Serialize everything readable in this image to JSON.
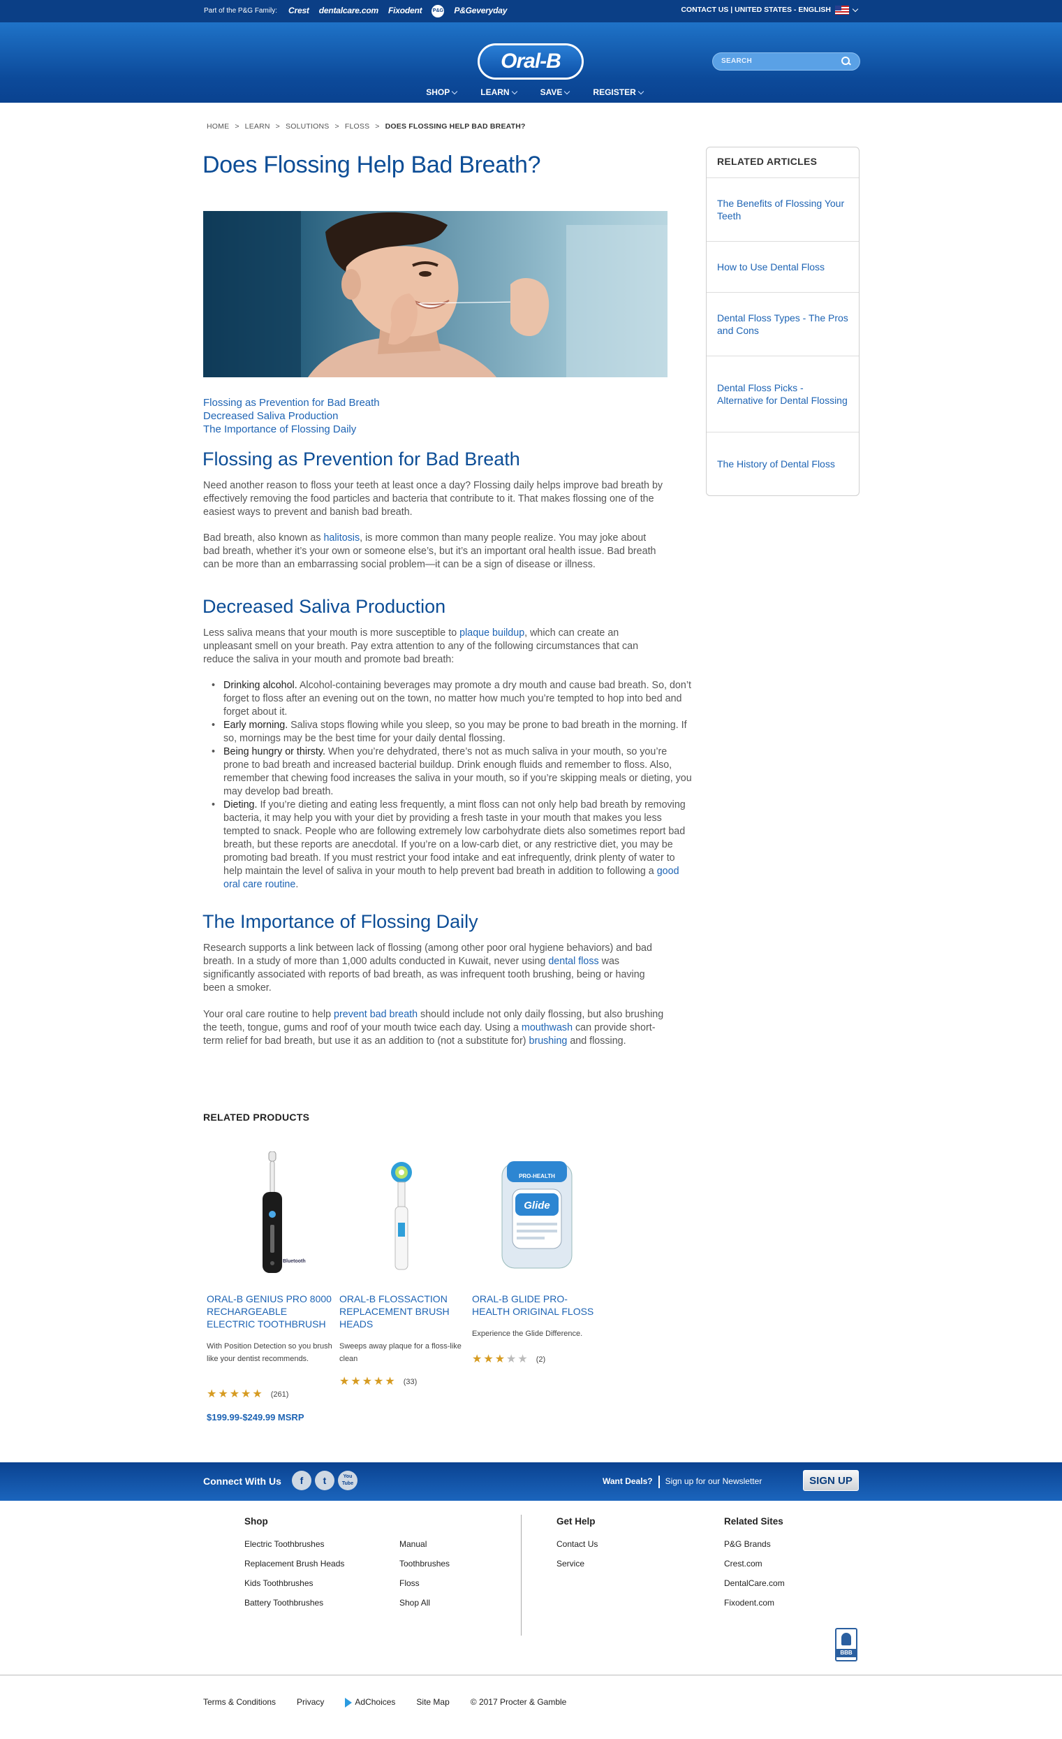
{
  "topbar": {
    "family_label": "Part of the P&G Family:",
    "brands": [
      "Crest",
      "dentalcare.com",
      "Fixodent",
      "P&G shop",
      "P&Geveryday"
    ],
    "right_text": "CONTACT US | UNITED STATES - ENGLISH"
  },
  "header": {
    "logo": "Oral-B",
    "search_placeholder": "SEARCH",
    "nav": [
      "SHOP",
      "LEARN",
      "SAVE",
      "REGISTER"
    ]
  },
  "breadcrumb": [
    "HOME",
    ">",
    "LEARN",
    ">",
    "SOLUTIONS",
    ">",
    "FLOSS",
    ">",
    "DOES FLOSSING HELP BAD BREATH?"
  ],
  "article": {
    "title": "Does Flossing Help Bad Breath?",
    "toc": [
      "Flossing as Prevention for Bad Breath",
      "Decreased Saliva Production",
      "The Importance of Flossing Daily"
    ],
    "h_prevention": "Flossing as Prevention for Bad Breath",
    "p1": "Need another reason to floss your teeth at least once a day? Flossing daily helps improve bad breath by effectively removing the food particles and bacteria that contribute to it. That makes flossing one of the easiest ways to prevent and banish bad breath.",
    "p2_a": "Bad breath, also known as ",
    "p2_link": "halitosis",
    "p2_b": ", is more common than many people realize. You may joke about bad breath, whether it’s your own or someone else’s, but it’s an important oral health issue. Bad breath can be more than an embarrassing social problem—it can be a sign of disease or illness.",
    "h_saliva": "Decreased Saliva Production",
    "p3_a": "Less saliva means that your mouth is more susceptible to ",
    "p3_link": "plaque buildup",
    "p3_b": ", which can create an unpleasant smell on your breath. Pay extra attention to any of the following circumstances that can reduce the saliva in your mouth and promote bad breath:",
    "bullets": [
      {
        "key": "Drinking alcohol.",
        "text": " Alcohol-containing beverages may promote a dry mouth and cause bad breath. So, don’t forget to floss after an evening out on the town, no matter how much you’re tempted to hop into bed and forget about it."
      },
      {
        "key": "Early morning.",
        "text": " Saliva stops flowing while you sleep, so you may be prone to bad breath in the morning. If so, mornings may be the best time for your daily dental flossing."
      },
      {
        "key": "Being hungry or thirsty.",
        "text": " When you’re dehydrated, there’s not as much saliva in your mouth, so you’re prone to bad breath and increased bacterial buildup. Drink enough fluids and remember to floss. Also, remember that chewing food increases the saliva in your mouth, so if you’re skipping meals or dieting, you may develop bad breath."
      },
      {
        "key": "Dieting.",
        "text": " If you’re dieting and eating less frequently, a mint floss can not only help bad breath by removing bacteria, it may help you with your diet by providing a fresh taste in your mouth that makes you less tempted to snack. People who are following extremely low carbohydrate diets also sometimes report bad breath, but these reports are anecdotal. If you’re on a low-carb diet, or any restrictive diet, you may be promoting bad breath. If you must restrict your food intake and eat infrequently, drink plenty of water to help maintain the level of saliva in your mouth to help prevent bad breath in addition to following a ",
        "link": "good oral care routine",
        "end": "."
      }
    ],
    "h_importance": "The Importance of Flossing Daily",
    "p4_a": "Research supports a link between lack of flossing (among other poor oral hygiene behaviors) and bad breath. In a study of more than 1,000 adults conducted in Kuwait, never using ",
    "p4_link": "dental floss",
    "p4_b": " was significantly associated with reports of bad breath, as was infrequent tooth brushing, being or having been a smoker.",
    "p5_a": "Your oral care routine to help ",
    "p5_link1": "prevent bad breath",
    "p5_b": " should include not only daily flossing, but also brushing the teeth, tongue, gums and roof of your mouth twice each day. Using a ",
    "p5_link2": "mouthwash",
    "p5_c": " can provide short-term relief for bad breath, but use it as an addition to (not a substitute for) ",
    "p5_link3": "brushing",
    "p5_d": " and flossing."
  },
  "sidebar": {
    "heading": "RELATED ARTICLES",
    "items": [
      "The Benefits of Flossing Your Teeth",
      "How to Use Dental Floss",
      "Dental Floss Types - The Pros and Cons",
      "Dental Floss Picks - Alternative for Dental Flossing",
      "The History of Dental Floss"
    ]
  },
  "related_products": {
    "heading": "RELATED PRODUCTS",
    "items": [
      {
        "name": "ORAL-B GENIUS PRO 8000 RECHARGEABLE ELECTRIC TOOTHBRUSH",
        "desc": "With Position Detection so you brush like your dentist recommends.",
        "rating": 5,
        "count": "(261)",
        "price": "$199.99-$249.99 MSRP",
        "badge": "Bluetooth"
      },
      {
        "name": "ORAL-B FLOSSACTION REPLACEMENT BRUSH HEADS",
        "desc": "Sweeps away plaque for a floss-like clean",
        "rating": 5,
        "count": "(33)",
        "price": ""
      },
      {
        "name": "ORAL-B GLIDE PRO-HEALTH ORIGINAL FLOSS",
        "desc": "Experience the Glide Difference.",
        "rating": 3,
        "count": "(2)",
        "price": "",
        "pack_brand": "Glide",
        "pack_line": "PRO-HEALTH"
      }
    ]
  },
  "footer": {
    "connect": "Connect With Us",
    "social": [
      "f",
      "t",
      "You Tube"
    ],
    "deals": "Want Deals?",
    "newsletter": "Sign up for our Newsletter",
    "signup": "SIGN UP",
    "shop_heading": "Shop",
    "shop_col1": [
      "Electric Toothbrushes",
      "Replacement Brush Heads",
      "Kids Toothbrushes",
      "Battery Toothbrushes"
    ],
    "shop_col2": [
      "Manual",
      "Toothbrushes",
      "Floss",
      "Shop All"
    ],
    "help_heading": "Get Help",
    "help": [
      "Contact Us",
      "Service"
    ],
    "sites_heading": "Related Sites",
    "sites": [
      "P&G Brands",
      "Crest.com",
      "DentalCare.com",
      "Fixodent.com"
    ],
    "bbb": "BBB",
    "legal": [
      "Terms & Conditions",
      "Privacy",
      "AdChoices",
      "Site Map",
      "© 2017 Procter & Gamble"
    ]
  },
  "colors": {
    "brand_blue": "#0c4d96",
    "link": "#1e64b4",
    "star": "#d69b21"
  }
}
